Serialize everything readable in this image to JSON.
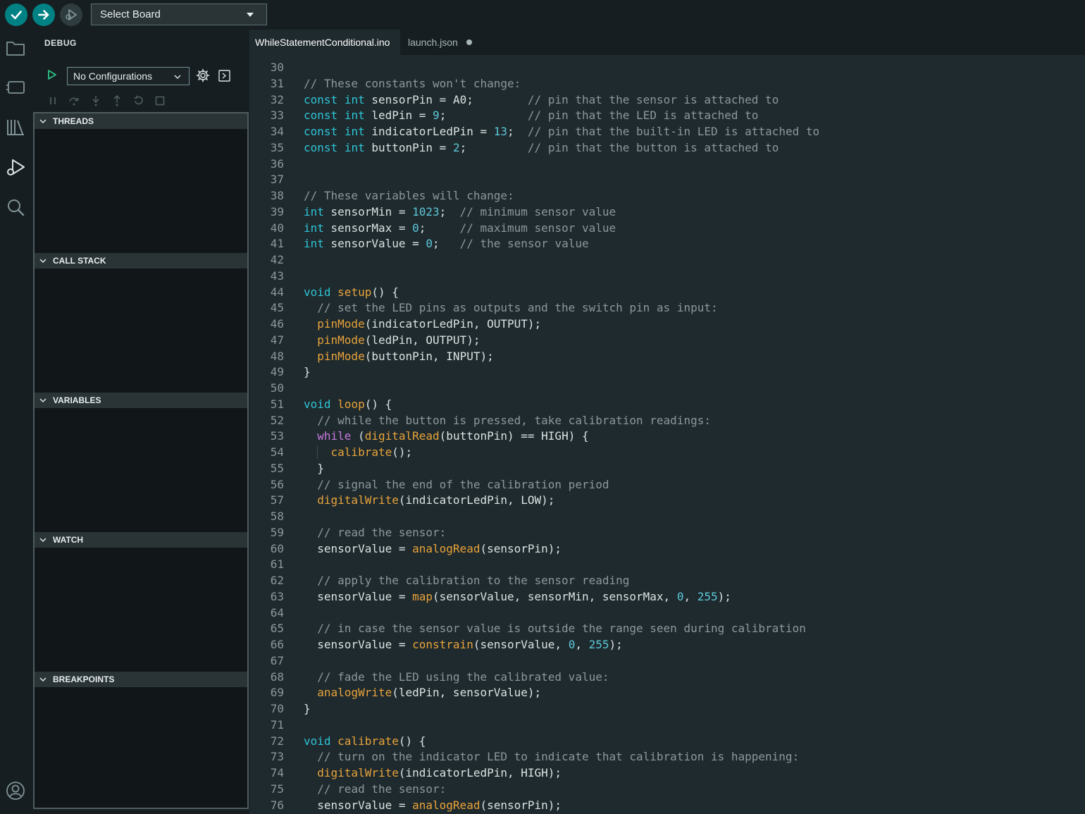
{
  "toolbar": {
    "verify_icon": "checkmark-icon",
    "upload_icon": "arrow-right-icon",
    "debug_icon": "debug-play-icon",
    "board_select": {
      "value": "Select Board",
      "icon": "caret-down-icon"
    },
    "accent_color": "#008184"
  },
  "activity_bar": {
    "items": [
      {
        "icon": "folder-icon",
        "label": "Sketchbook"
      },
      {
        "icon": "board-icon",
        "label": "Boards Manager"
      },
      {
        "icon": "library-icon",
        "label": "Library Manager"
      },
      {
        "icon": "debug-icon",
        "label": "Debug"
      },
      {
        "icon": "search-icon",
        "label": "Search"
      },
      {
        "icon": "account-icon",
        "label": "Account"
      }
    ]
  },
  "debug_panel": {
    "title": "DEBUG",
    "config_select": {
      "value": "No Configurations"
    },
    "controls": [
      "pause-icon",
      "step-over-icon",
      "step-into-icon",
      "step-out-icon",
      "restart-icon",
      "stop-icon"
    ],
    "sections": [
      {
        "id": "threads",
        "label": "THREADS"
      },
      {
        "id": "call-stack",
        "label": "CALL STACK"
      },
      {
        "id": "variables",
        "label": "VARIABLES"
      },
      {
        "id": "watch",
        "label": "WATCH"
      },
      {
        "id": "breakpoints",
        "label": "BREAKPOINTS"
      }
    ]
  },
  "editor": {
    "tabs": [
      {
        "label": "WhileStatementConditional.ino",
        "active": true
      },
      {
        "label": "launch.json",
        "active": false,
        "modified": true
      }
    ],
    "code_lines": [
      {
        "n": "30",
        "t": ""
      },
      {
        "n": "31",
        "t": "// These constants won't change:"
      },
      {
        "n": "32",
        "t": "const int sensorPin = A0;        // pin that the sensor is attached to"
      },
      {
        "n": "33",
        "t": "const int ledPin = 9;            // pin that the LED is attached to"
      },
      {
        "n": "34",
        "t": "const int indicatorLedPin = 13;  // pin that the built-in LED is attached to"
      },
      {
        "n": "35",
        "t": "const int buttonPin = 2;         // pin that the button is attached to"
      },
      {
        "n": "36",
        "t": ""
      },
      {
        "n": "37",
        "t": ""
      },
      {
        "n": "38",
        "t": "// These variables will change:"
      },
      {
        "n": "39",
        "t": "int sensorMin = 1023;  // minimum sensor value"
      },
      {
        "n": "40",
        "t": "int sensorMax = 0;     // maximum sensor value"
      },
      {
        "n": "41",
        "t": "int sensorValue = 0;   // the sensor value"
      },
      {
        "n": "42",
        "t": ""
      },
      {
        "n": "43",
        "t": ""
      },
      {
        "n": "44",
        "t": "void setup() {"
      },
      {
        "n": "45",
        "t": "  // set the LED pins as outputs and the switch pin as input:"
      },
      {
        "n": "46",
        "t": "  pinMode(indicatorLedPin, OUTPUT);"
      },
      {
        "n": "47",
        "t": "  pinMode(ledPin, OUTPUT);"
      },
      {
        "n": "48",
        "t": "  pinMode(buttonPin, INPUT);"
      },
      {
        "n": "49",
        "t": "}"
      },
      {
        "n": "50",
        "t": ""
      },
      {
        "n": "51",
        "t": "void loop() {"
      },
      {
        "n": "52",
        "t": "  // while the button is pressed, take calibration readings:"
      },
      {
        "n": "53",
        "t": "  while (digitalRead(buttonPin) == HIGH) {"
      },
      {
        "n": "54",
        "t": "    calibrate();"
      },
      {
        "n": "55",
        "t": "  }"
      },
      {
        "n": "56",
        "t": "  // signal the end of the calibration period"
      },
      {
        "n": "57",
        "t": "  digitalWrite(indicatorLedPin, LOW);"
      },
      {
        "n": "58",
        "t": ""
      },
      {
        "n": "59",
        "t": "  // read the sensor:"
      },
      {
        "n": "60",
        "t": "  sensorValue = analogRead(sensorPin);"
      },
      {
        "n": "61",
        "t": ""
      },
      {
        "n": "62",
        "t": "  // apply the calibration to the sensor reading"
      },
      {
        "n": "63",
        "t": "  sensorValue = map(sensorValue, sensorMin, sensorMax, 0, 255);"
      },
      {
        "n": "64",
        "t": ""
      },
      {
        "n": "65",
        "t": "  // in case the sensor value is outside the range seen during calibration"
      },
      {
        "n": "66",
        "t": "  sensorValue = constrain(sensorValue, 0, 255);"
      },
      {
        "n": "67",
        "t": ""
      },
      {
        "n": "68",
        "t": "  // fade the LED using the calibrated value:"
      },
      {
        "n": "69",
        "t": "  analogWrite(ledPin, sensorValue);"
      },
      {
        "n": "70",
        "t": "}"
      },
      {
        "n": "71",
        "t": ""
      },
      {
        "n": "72",
        "t": "void calibrate() {"
      },
      {
        "n": "73",
        "t": "  // turn on the indicator LED to indicate that calibration is happening:"
      },
      {
        "n": "74",
        "t": "  digitalWrite(indicatorLedPin, HIGH);"
      },
      {
        "n": "75",
        "t": "  // read the sensor:"
      },
      {
        "n": "76",
        "t": "  sensorValue = analogRead(sensorPin);"
      }
    ]
  }
}
